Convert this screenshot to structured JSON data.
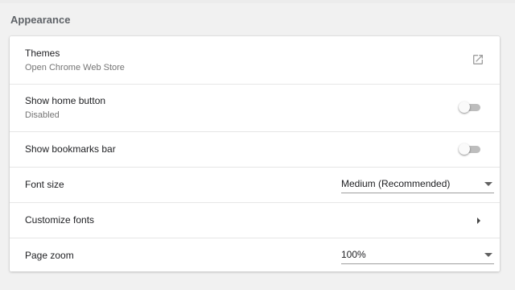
{
  "section": {
    "title": "Appearance"
  },
  "rows": {
    "themes": {
      "label": "Themes",
      "sublabel": "Open Chrome Web Store",
      "icon": "external-link-icon"
    },
    "home_button": {
      "label": "Show home button",
      "sublabel": "Disabled",
      "enabled": false
    },
    "bookmarks_bar": {
      "label": "Show bookmarks bar",
      "enabled": false
    },
    "font_size": {
      "label": "Font size",
      "selected": "Medium (Recommended)"
    },
    "customize_fonts": {
      "label": "Customize fonts"
    },
    "page_zoom": {
      "label": "Page zoom",
      "selected": "100%"
    }
  }
}
